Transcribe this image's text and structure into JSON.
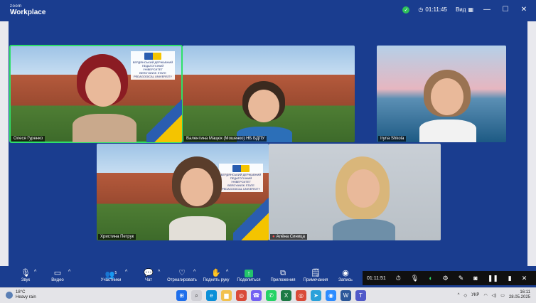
{
  "titlebar": {
    "brand_small": "zoom",
    "brand_main": "Workplace",
    "timer": "01:11:45",
    "view_label": "Вид",
    "win_minimize": "—",
    "win_maximize": "☐",
    "win_close": "✕"
  },
  "participants": [
    {
      "name": "Олеся Гуренко",
      "active": true
    },
    {
      "name": "Валентина Мацюк (Мошенко) НБ БДПУ",
      "active": false
    },
    {
      "name": "Iryna Shkola",
      "active": false
    },
    {
      "name": "Христина Петрук",
      "active": false
    },
    {
      "name": "Алёна Синица",
      "active": false
    }
  ],
  "logo": {
    "line1": "БЕРДЯНСЬКИЙ ДЕРЖАВНИЙ",
    "line2": "ПЕДАГОГІЧНИЙ УНІВЕРСИТЕТ",
    "line3": "BERDYANSK STATE",
    "line4": "PEDAGOGICAL UNIVERSITY"
  },
  "toolbar": {
    "audio": "Звук",
    "video": "Видео",
    "participants": "Участники",
    "participants_count": "5",
    "chat": "Чат",
    "react": "Отреагировать",
    "raise_hand": "Поднять руку",
    "share": "Поделиться",
    "apps": "Приложения",
    "notes": "Примечания",
    "record": "Запись"
  },
  "overlay": {
    "time": "01:11:51"
  },
  "taskbar": {
    "temp": "18°C",
    "weather": "Heavy rain",
    "lang": "УКР",
    "time": "16:11",
    "date": "28.05.2025"
  },
  "colors": {
    "zoom_blue": "#1a3d8f",
    "active_border": "#2fe06a",
    "share_green": "#23c36b"
  }
}
